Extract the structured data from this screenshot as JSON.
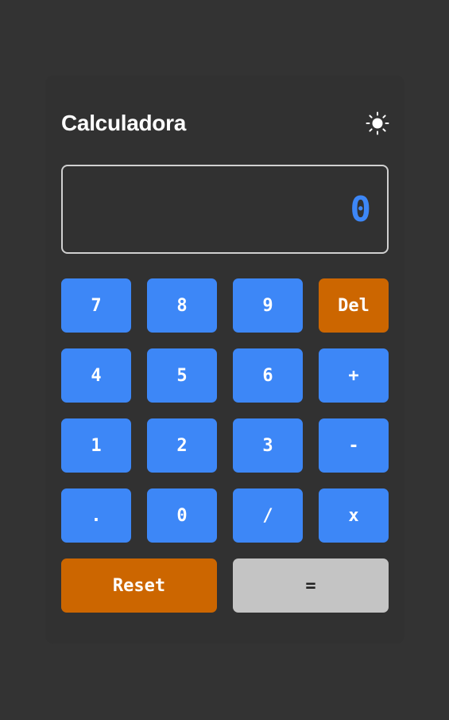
{
  "header": {
    "title": "Calculadora",
    "theme_icon": "sun-icon"
  },
  "display": {
    "value": "0"
  },
  "keys": {
    "k7": "7",
    "k8": "8",
    "k9": "9",
    "del": "Del",
    "k4": "4",
    "k5": "5",
    "k6": "6",
    "plus": "+",
    "k1": "1",
    "k2": "2",
    "k3": "3",
    "minus": "-",
    "dot": ".",
    "k0": "0",
    "divide": "/",
    "multiply": "x",
    "reset": "Reset",
    "equals": "="
  },
  "colors": {
    "background": "#333333",
    "card": "#313131",
    "key_blue": "#3d87f7",
    "key_orange": "#cc6600",
    "key_equals": "#c4c4c4",
    "display_text": "#3d87f7"
  }
}
